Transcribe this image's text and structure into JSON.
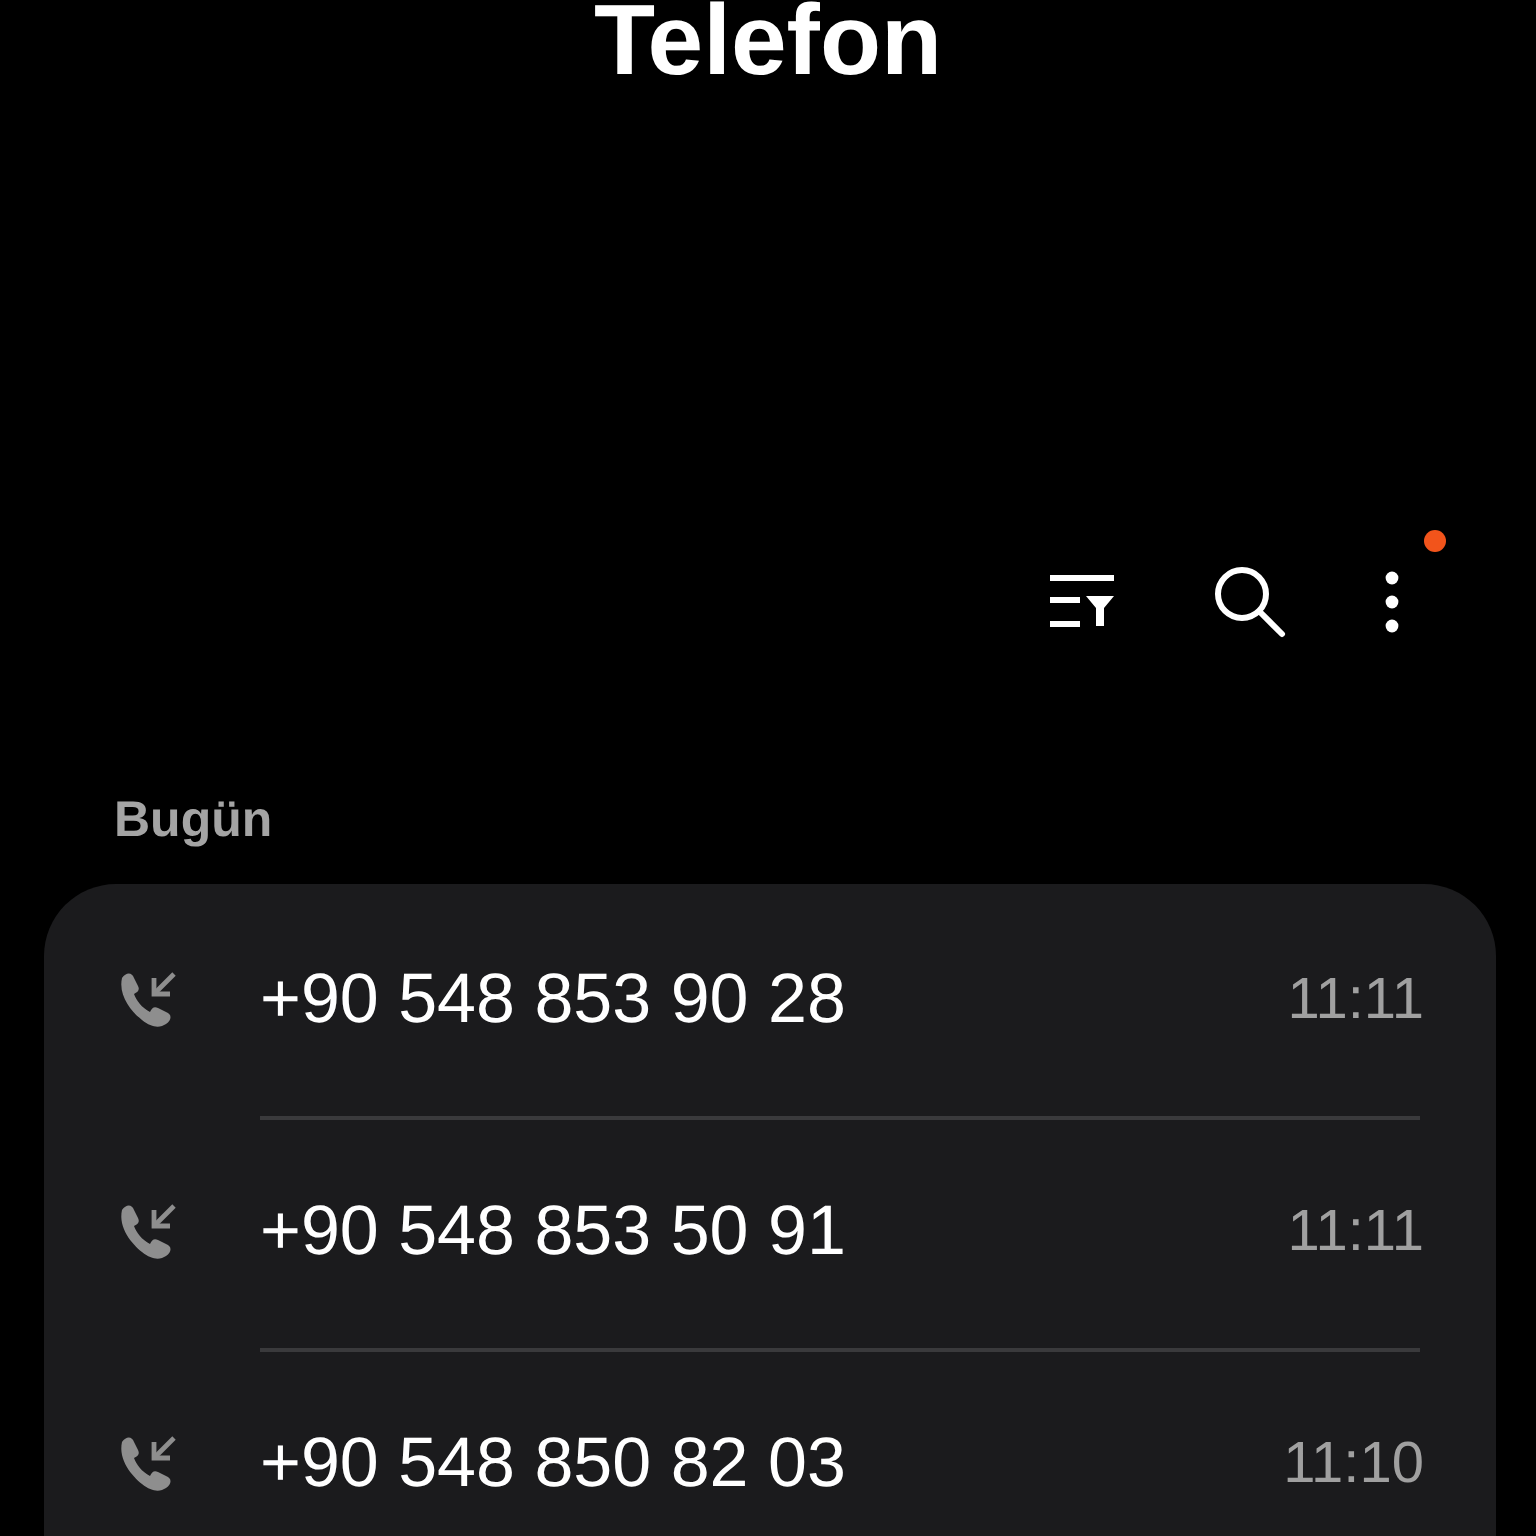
{
  "title": "Telefon",
  "toolbar": {
    "menu_badge": true
  },
  "section": "Bugün",
  "calls": [
    {
      "kind": "incoming",
      "number": "+90 548 853 90 28",
      "time": "11:11"
    },
    {
      "kind": "incoming",
      "number": "+90 548 853 50 91",
      "time": "11:11"
    },
    {
      "kind": "incoming",
      "number": "+90 548 850 82 03",
      "time": "11:10"
    }
  ]
}
